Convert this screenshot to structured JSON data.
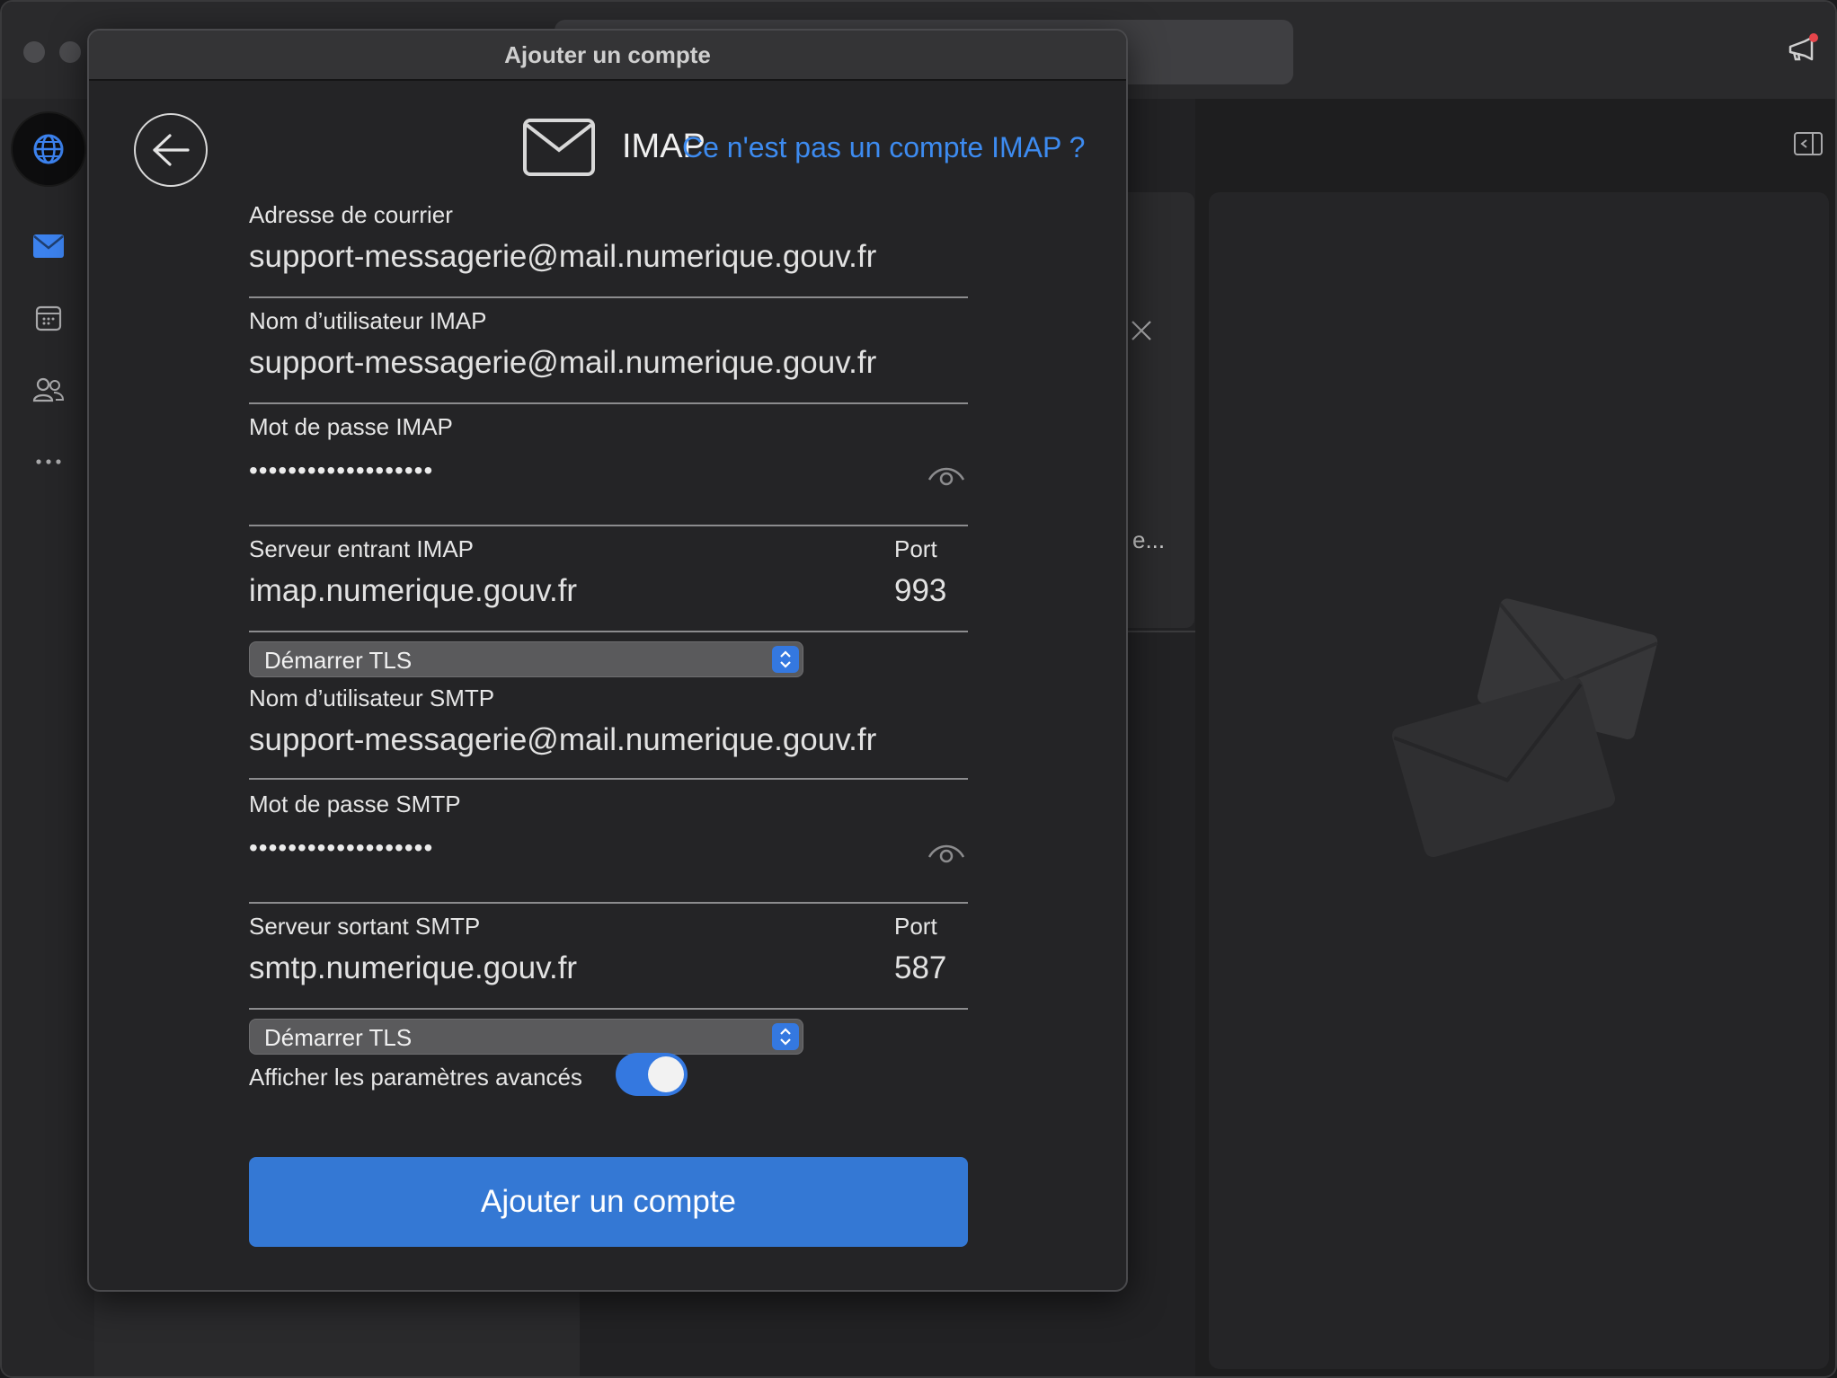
{
  "modal": {
    "title": "Ajouter un compte",
    "protocol": "IMAP",
    "not_imap_link": "Ce n'est pas un compte IMAP ?"
  },
  "fields": {
    "email": {
      "label": "Adresse de courrier",
      "value": "support-messagerie@mail.numerique.gouv.fr"
    },
    "imap_username": {
      "label": "Nom d’utilisateur IMAP",
      "value": "support-messagerie@mail.numerique.gouv.fr"
    },
    "imap_password": {
      "label": "Mot de passe IMAP",
      "value": "•••••••••••••••••••"
    },
    "imap_server": {
      "label": "Serveur entrant IMAP",
      "value": "imap.numerique.gouv.fr",
      "port_label": "Port",
      "port": "993"
    },
    "imap_security": {
      "value": "Démarrer TLS"
    },
    "smtp_username": {
      "label": "Nom d’utilisateur SMTP",
      "value": "support-messagerie@mail.numerique.gouv.fr"
    },
    "smtp_password": {
      "label": "Mot de passe SMTP",
      "value": "•••••••••••••••••••"
    },
    "smtp_server": {
      "label": "Serveur sortant SMTP",
      "value": "smtp.numerique.gouv.fr",
      "port_label": "Port",
      "port": "587"
    },
    "smtp_security": {
      "value": "Démarrer TLS"
    }
  },
  "advanced_toggle": {
    "label": "Afficher les paramètres avancés",
    "on": true
  },
  "submit_label": "Ajouter un compte",
  "background": {
    "truncated_text": "e..."
  },
  "colors": {
    "accent": "#3478d4",
    "link": "#3d8bf0",
    "panel": "#242426"
  },
  "icons": [
    "back-arrow-icon",
    "mail-icon",
    "eye-icon",
    "globe-icon",
    "calendar-icon",
    "people-icon",
    "more-icon",
    "megaphone-icon",
    "sidebar-toggle-icon",
    "filter-icon",
    "close-icon",
    "chevron-updown-icon"
  ]
}
